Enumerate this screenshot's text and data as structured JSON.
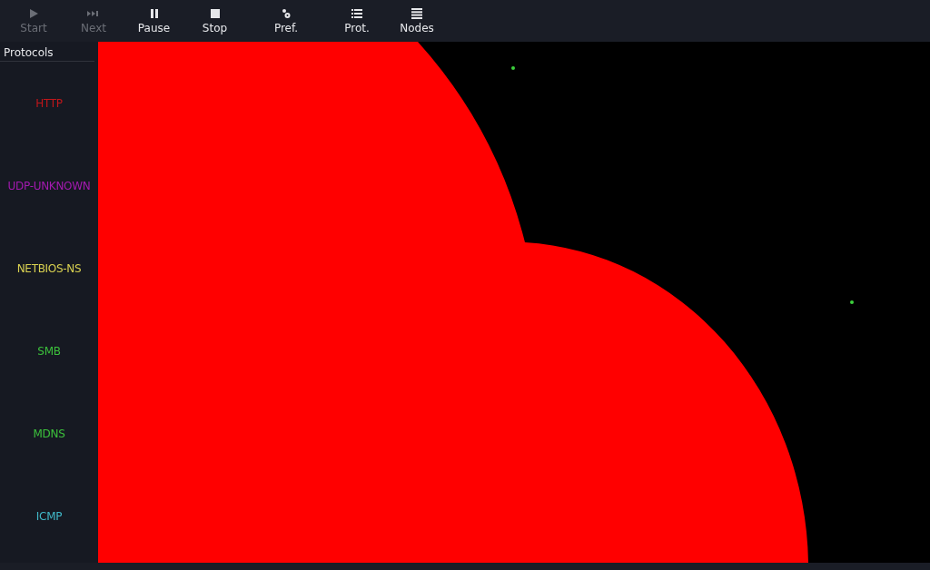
{
  "toolbar": [
    {
      "kind": "play",
      "label": "Start",
      "disabled": true
    },
    {
      "kind": "next",
      "label": "Next",
      "disabled": true
    },
    {
      "kind": "pause",
      "label": "Pause",
      "disabled": false
    },
    {
      "kind": "stop",
      "label": "Stop",
      "disabled": false
    },
    {
      "kind": "prefs",
      "label": "Pref.",
      "disabled": false
    },
    {
      "kind": "list",
      "label": "Prot.",
      "disabled": false
    },
    {
      "kind": "lines",
      "label": "Nodes",
      "disabled": false
    }
  ],
  "sidebar": {
    "title": "Protocols",
    "items": [
      {
        "label": "HTTP",
        "color": "#c0161a"
      },
      {
        "label": "UDP-UNKNOWN",
        "color": "#a41ab0"
      },
      {
        "label": "NETBIOS-NS",
        "color": "#d8d050"
      },
      {
        "label": "SMB",
        "color": "#3cc03c"
      },
      {
        "label": "MDNS",
        "color": "#3cc03c"
      },
      {
        "label": "ICMP",
        "color": "#40b8c8"
      }
    ]
  }
}
